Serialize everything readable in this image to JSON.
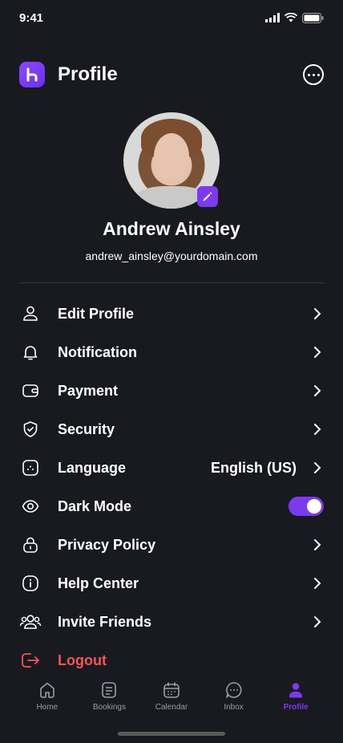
{
  "status_bar": {
    "time": "9:41"
  },
  "header": {
    "title": "Profile",
    "logo_icon": "brand-logo-icon",
    "more_icon": "more-icon"
  },
  "user": {
    "name": "Andrew Ainsley",
    "email": "andrew_ainsley@yourdomain.com"
  },
  "menu": {
    "edit_profile": "Edit Profile",
    "notification": "Notification",
    "payment": "Payment",
    "security": "Security",
    "language": "Language",
    "language_value": "English (US)",
    "dark_mode": "Dark Mode",
    "dark_mode_on": true,
    "privacy_policy": "Privacy Policy",
    "help_center": "Help Center",
    "invite_friends": "Invite Friends",
    "logout": "Logout"
  },
  "tabbar": {
    "home": "Home",
    "bookings": "Bookings",
    "calendar": "Calendar",
    "inbox": "Inbox",
    "profile": "Profile",
    "active": "profile"
  },
  "colors": {
    "accent": "#7c3aed",
    "background": "#181a20",
    "danger": "#f75555"
  }
}
